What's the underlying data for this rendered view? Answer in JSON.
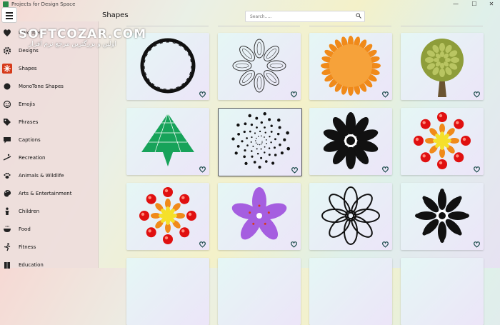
{
  "window": {
    "title": "Projects for Design Space",
    "controls": [
      "minimize",
      "maximize",
      "close"
    ]
  },
  "sidebar": {
    "menu_icon": "hamburger-icon",
    "items": [
      {
        "label": "Favorites",
        "icon": "heart-icon"
      },
      {
        "label": "Designs",
        "icon": "gear-icon"
      },
      {
        "label": "Shapes",
        "icon": "star-icon",
        "active": true
      },
      {
        "label": "MonoTone Shapes",
        "icon": "circle-icon"
      },
      {
        "label": "Emojis",
        "icon": "smiley-icon"
      },
      {
        "label": "Phrases",
        "icon": "tag-icon"
      },
      {
        "label": "Captions",
        "icon": "comment-icon"
      },
      {
        "label": "Recreation",
        "icon": "ski-icon"
      },
      {
        "label": "Animals & Wildlife",
        "icon": "paw-icon"
      },
      {
        "label": "Arts & Entertainment",
        "icon": "palette-icon"
      },
      {
        "label": "Children",
        "icon": "child-icon"
      },
      {
        "label": "Food",
        "icon": "food-icon"
      },
      {
        "label": "Fitness",
        "icon": "runner-icon"
      },
      {
        "label": "Education",
        "icon": "book-icon"
      }
    ]
  },
  "main": {
    "title": "Shapes",
    "search": {
      "placeholder": "Search.....",
      "value": ""
    }
  },
  "grid": {
    "cards": [
      {
        "shape": "circle-ring"
      },
      {
        "shape": "leaf-flower"
      },
      {
        "shape": "sun"
      },
      {
        "shape": "tree"
      },
      {
        "shape": "triangle-tree"
      },
      {
        "shape": "dot-spiral"
      },
      {
        "shape": "black-flower"
      },
      {
        "shape": "red-berry-flower"
      },
      {
        "shape": "red-berry-flower-2"
      },
      {
        "shape": "purple-pinwheel"
      },
      {
        "shape": "outline-flower"
      },
      {
        "shape": "ornament-flower"
      }
    ]
  },
  "watermark": {
    "line1": "SOFTCOZAR.COM",
    "line2": "ﺍﻭﻟﻴﻦ ﻭ ﺑﺰﺭﮔﺘﺮﻳﻦ ﻣﺮﺟﻊ ﻧﺮﻡ ﺍﻓﺰﺍﺭ"
  },
  "colors": {
    "accent": "#d63a1a",
    "heart": "#1e4d4d"
  }
}
